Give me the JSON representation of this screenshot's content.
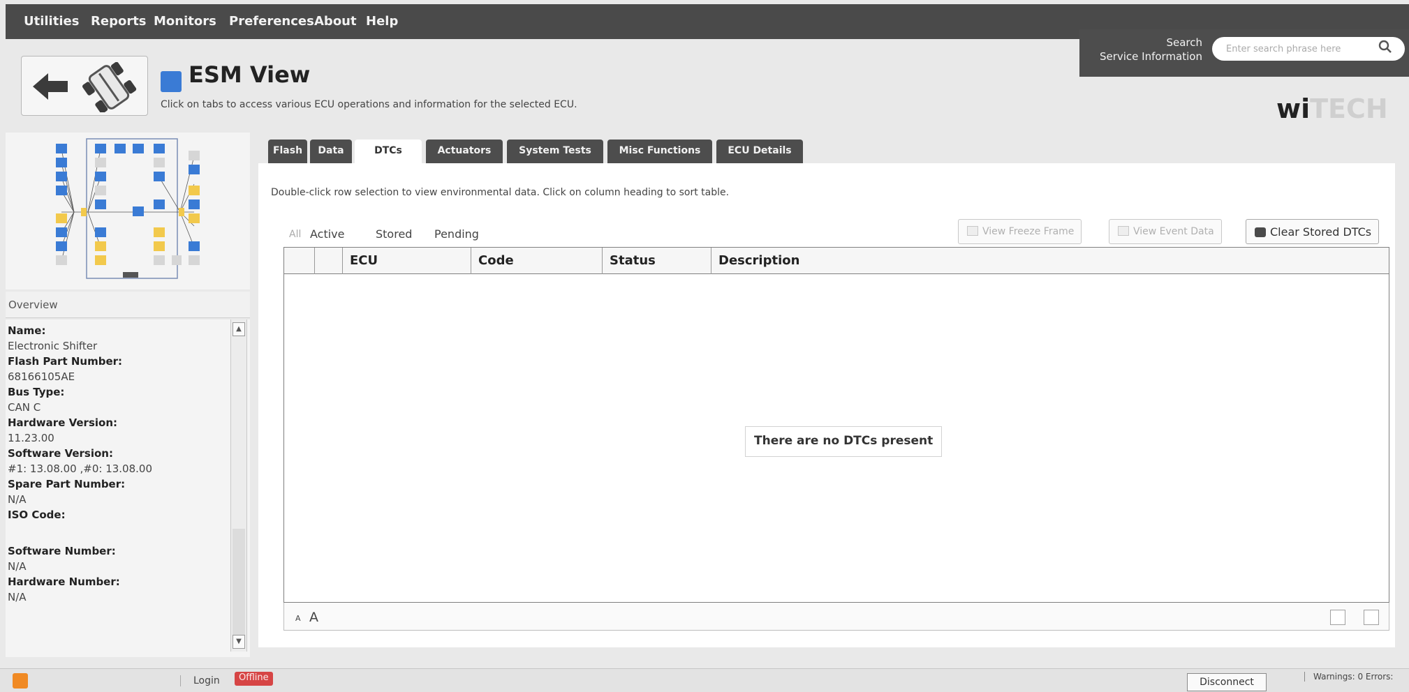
{
  "menu": {
    "items": [
      {
        "label": "Utilities"
      },
      {
        "label": "Reports"
      },
      {
        "label": "Monitors"
      },
      {
        "label": "Preferences"
      },
      {
        "label": "About"
      },
      {
        "label": "Help"
      }
    ]
  },
  "search": {
    "label_line1": "Search",
    "label_line2": "Service Information",
    "placeholder": "Enter search phrase here"
  },
  "header": {
    "title": "ESM View",
    "subtitle": "Click on tabs to access various ECU operations and information for the selected ECU.",
    "logo_part1": "wi",
    "logo_part2": "TECH",
    "back_icon": "arrow-left-icon",
    "vehicle_icon": "vehicle-chassis-icon"
  },
  "sidebar": {
    "overview_label": "Overview",
    "fields": [
      {
        "label": "Name:",
        "value": "Electronic Shifter"
      },
      {
        "label": "Flash Part Number:",
        "value": "68166105AE"
      },
      {
        "label": "Bus Type:",
        "value": "CAN C"
      },
      {
        "label": "Hardware Version:",
        "value": "11.23.00"
      },
      {
        "label": "Software Version:",
        "value": "#1: 13.08.00 ,#0: 13.08.00"
      },
      {
        "label": "Spare Part Number:",
        "value": "N/A"
      },
      {
        "label": "ISO Code:",
        "value": ""
      },
      {
        "label": "Software Number:",
        "value": "N/A"
      },
      {
        "label": "Hardware Number:",
        "value": "N/A"
      }
    ]
  },
  "tabs": [
    {
      "label": "Flash"
    },
    {
      "label": "Data"
    },
    {
      "label": "DTCs",
      "active": true
    },
    {
      "label": "Actuators"
    },
    {
      "label": "System Tests"
    },
    {
      "label": "Misc Functions"
    },
    {
      "label": "ECU Details"
    }
  ],
  "dtc": {
    "hint": "Double-click row selection to view environmental data.  Click on column heading to sort table.",
    "filters": {
      "all": "All",
      "active": "Active",
      "stored": "Stored",
      "pending": "Pending"
    },
    "buttons": {
      "view_freeze_frame": "View Freeze Frame",
      "view_event_data": "View Event Data",
      "clear_stored": "Clear Stored DTCs"
    },
    "columns": [
      "ECU",
      "Code",
      "Status",
      "Description"
    ],
    "empty_message": "There are no DTCs present",
    "font_small": "A",
    "font_large": "A"
  },
  "status": {
    "login": "Login",
    "offline": "Offline",
    "disconnect": "Disconnect",
    "warnings": "Warnings: 0 Errors:"
  },
  "colors": {
    "menubar": "#4a4a4a",
    "ecu_blue": "#3a7bd5",
    "ecu_yellow": "#f2c94c",
    "offline_red": "#d64545"
  }
}
